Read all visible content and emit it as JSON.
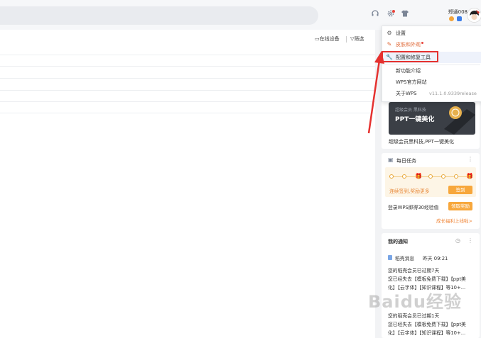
{
  "header": {
    "username": "郑通008",
    "icons": [
      "headset-icon",
      "gear-icon",
      "shirt-icon"
    ]
  },
  "toolbar": {
    "online_devices": "在线设备",
    "filter": "筛选"
  },
  "menu": {
    "items": [
      {
        "icon": "gear-icon",
        "label": "设置"
      },
      {
        "icon": "brush-icon",
        "label": "皮肤和外观"
      },
      {
        "icon": "wrench-icon",
        "label": "配置和修复工具"
      },
      {
        "icon": "",
        "label": "新功能介绍"
      },
      {
        "icon": "",
        "label": "WPS官方网站"
      },
      {
        "icon": "",
        "label": "关于WPS"
      }
    ],
    "version": "v11.1.0.9339release"
  },
  "promo": {
    "subtitle": "超级会员 黑科技",
    "title": "PPT一键美化",
    "caption": "超级会员黑科技,PPT一键美化"
  },
  "tasks": {
    "title": "每日任务",
    "checkin_text": "连续签到,奖励更多",
    "checkin_button": "签到",
    "login_text": "登录WPS即得30经验值",
    "claim_button": "领取奖励",
    "growth_link": "成长福利上线啦>"
  },
  "notices": {
    "title": "我的通知",
    "item1_source": "稻壳消息",
    "item1_time": "昨天 09:21",
    "item1_line1": "您的稻壳会员已过期7天",
    "item1_line2": "您已经失去【模板免费下载】【ppt美",
    "item1_line3": "化】【云字体】【知识课程】等10+...",
    "item2_line1": "您的稻壳会员已过期1天",
    "item2_line2": "您已经失去【模板免费下载】【ppt美",
    "item2_line3": "化】【云字体】【知识课程】等10+..."
  },
  "watermark": "Baidu经验"
}
